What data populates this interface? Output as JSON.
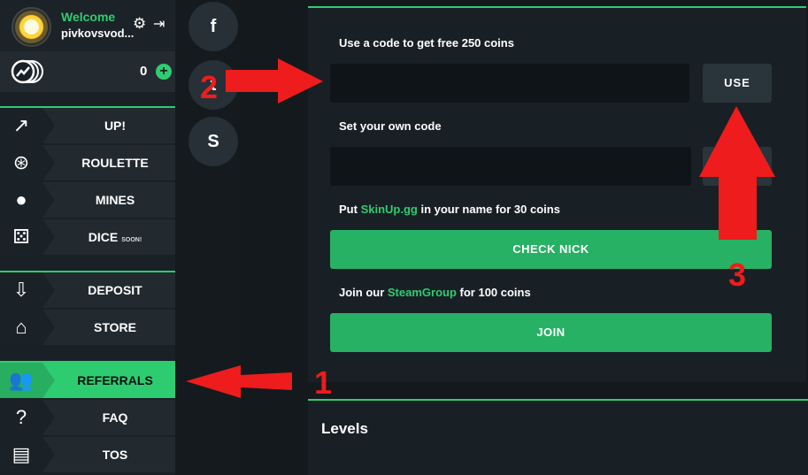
{
  "profile": {
    "welcome": "Welcome",
    "username": "pivkovsvod...",
    "settings_icon": "gear-icon",
    "logout_icon": "logout-icon"
  },
  "balance": {
    "value": "0",
    "add_label": "+"
  },
  "menu": {
    "games": [
      {
        "label": "UP!",
        "icon": "trend-up-icon"
      },
      {
        "label": "ROULETTE",
        "icon": "roulette-icon"
      },
      {
        "label": "MINES",
        "icon": "bomb-icon"
      },
      {
        "label": "DICE",
        "badge": "SOON!",
        "icon": "dice-icon"
      }
    ],
    "shop": [
      {
        "label": "DEPOSIT",
        "icon": "deposit-icon"
      },
      {
        "label": "STORE",
        "icon": "store-icon"
      }
    ],
    "info": [
      {
        "label": "REFERRALS",
        "icon": "users-icon",
        "active": true
      },
      {
        "label": "FAQ",
        "icon": "question-icon"
      },
      {
        "label": "TOS",
        "icon": "document-icon"
      }
    ]
  },
  "social": [
    {
      "name": "facebook",
      "glyph": "f"
    },
    {
      "name": "twitter",
      "glyph": "t"
    },
    {
      "name": "steam",
      "glyph": "S"
    }
  ],
  "referrals": {
    "use_code_label": "Use a code to get free 250 coins",
    "use_code_value": "",
    "use_button": "USE",
    "own_code_label": "Set your own code",
    "own_code_value": "",
    "nick_prefix": "Put ",
    "nick_highlight": "SkinUp.gg",
    "nick_suffix": " in your name for 30 coins",
    "check_nick_button": "CHECK NICK",
    "join_prefix": "Join our ",
    "join_highlight": "SteamGroup",
    "join_suffix": " for 100 coins",
    "join_button": "JOIN"
  },
  "levels": {
    "title": "Levels"
  },
  "annotations": {
    "one": "1",
    "two": "2",
    "three": "3",
    "color": "#ee1c1c"
  },
  "colors": {
    "accent": "#2ecc71",
    "button_green": "#27b164",
    "annotation": "#ee1c1c"
  }
}
